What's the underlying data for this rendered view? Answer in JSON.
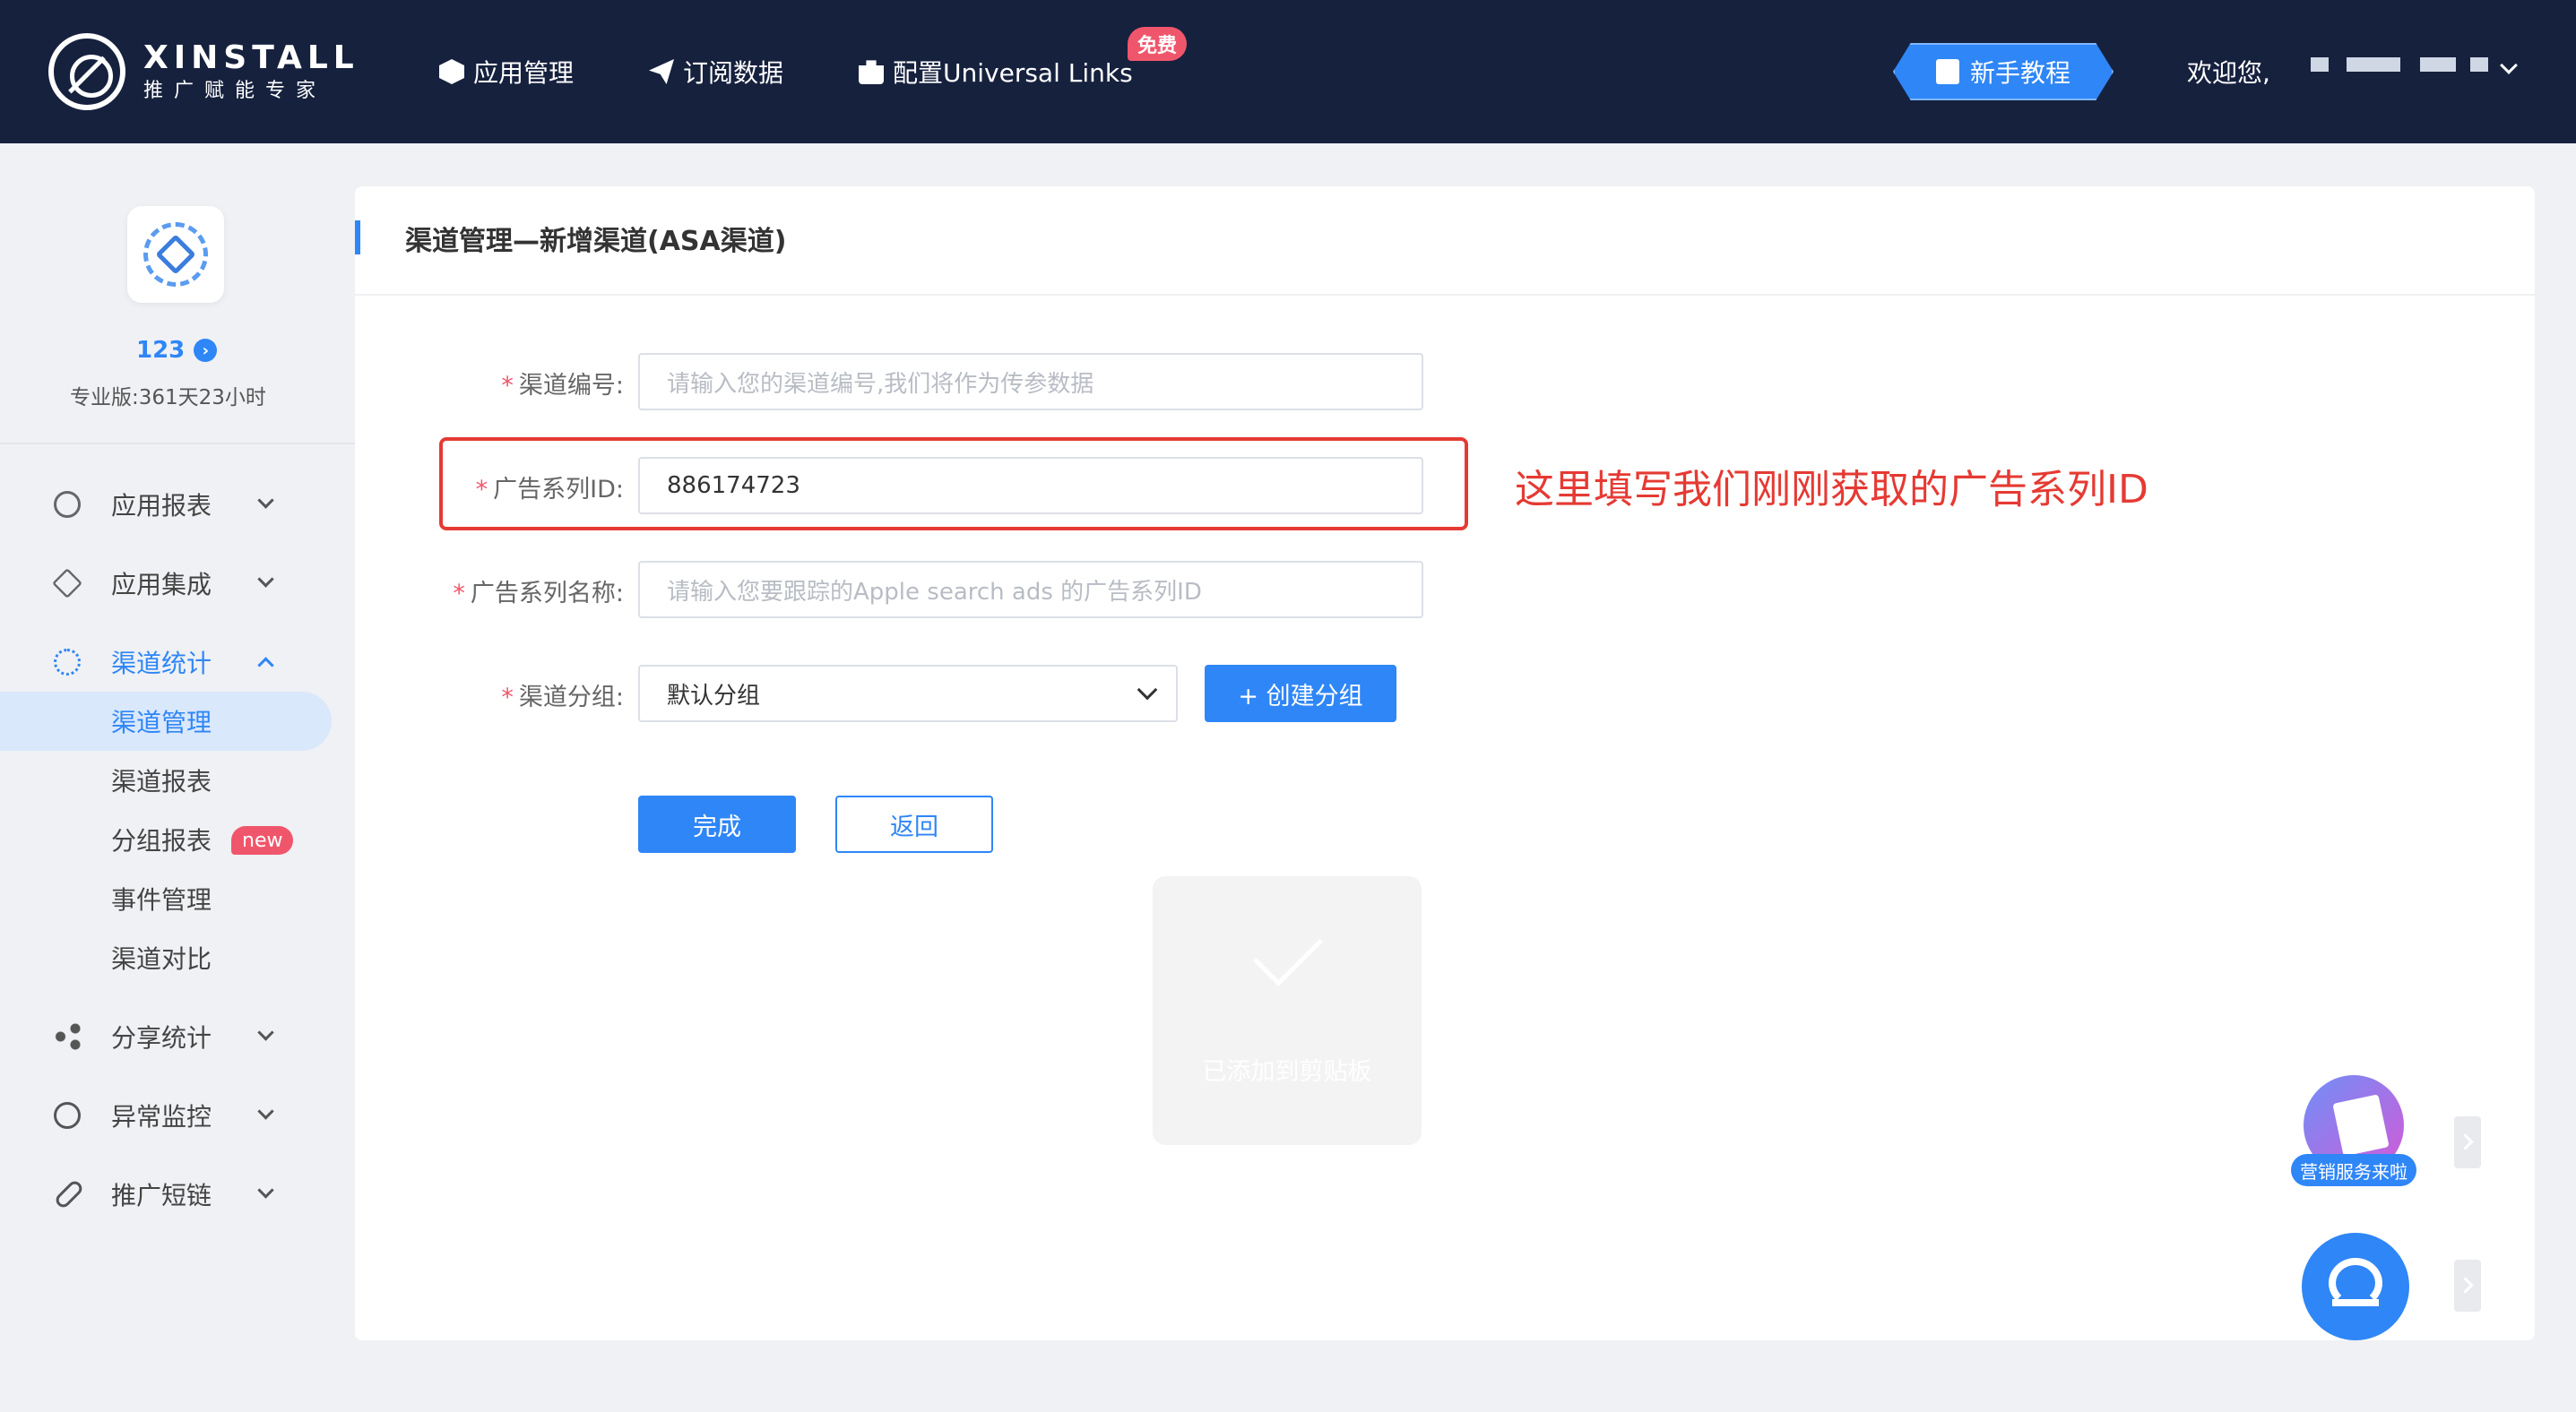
{
  "brand": {
    "title": "XINSTALL",
    "subtitle": "推广赋能专家"
  },
  "nav": {
    "items": [
      {
        "label": "应用管理",
        "icon": "cube-icon"
      },
      {
        "label": "订阅数据",
        "icon": "paper-plane-icon"
      },
      {
        "label": "配置Universal Links",
        "icon": "briefcase-icon"
      }
    ],
    "free_badge": "免费",
    "tutorial": "新手教程",
    "welcome": "欢迎您,"
  },
  "sidebar": {
    "app_name": "123",
    "plan": "专业版:361天23小时",
    "menu": [
      {
        "label": "应用报表"
      },
      {
        "label": "应用集成"
      },
      {
        "label": "渠道统计"
      },
      {
        "label": "分享统计"
      },
      {
        "label": "异常监控"
      },
      {
        "label": "推广短链"
      }
    ],
    "submenu": [
      {
        "label": "渠道管理"
      },
      {
        "label": "渠道报表"
      },
      {
        "label": "分组报表",
        "badge": "new"
      },
      {
        "label": "事件管理"
      },
      {
        "label": "渠道对比"
      }
    ]
  },
  "page": {
    "title": "渠道管理—新增渠道(ASA渠道)",
    "form": {
      "channel_no": {
        "label": "渠道编号:",
        "placeholder": "请输入您的渠道编号,我们将作为传参数据"
      },
      "campaign_id": {
        "label": "广告系列ID:",
        "value": "886174723"
      },
      "campaign_name": {
        "label": "广告系列名称:",
        "placeholder": "请输入您要跟踪的Apple search ads 的广告系列ID"
      },
      "group": {
        "label": "渠道分组:",
        "value": "默认分组",
        "create_btn": "+ 创建分组"
      }
    },
    "done_btn": "完成",
    "back_btn": "返回",
    "annotation": "这里填写我们刚刚获取的广告系列ID",
    "toast": "已添加到剪贴板",
    "promo_label": "营销服务来啦"
  },
  "colors": {
    "primary": "#2f86f6",
    "topbar": "#16213e",
    "alert": "#e53a33",
    "badge": "#f0566b"
  }
}
